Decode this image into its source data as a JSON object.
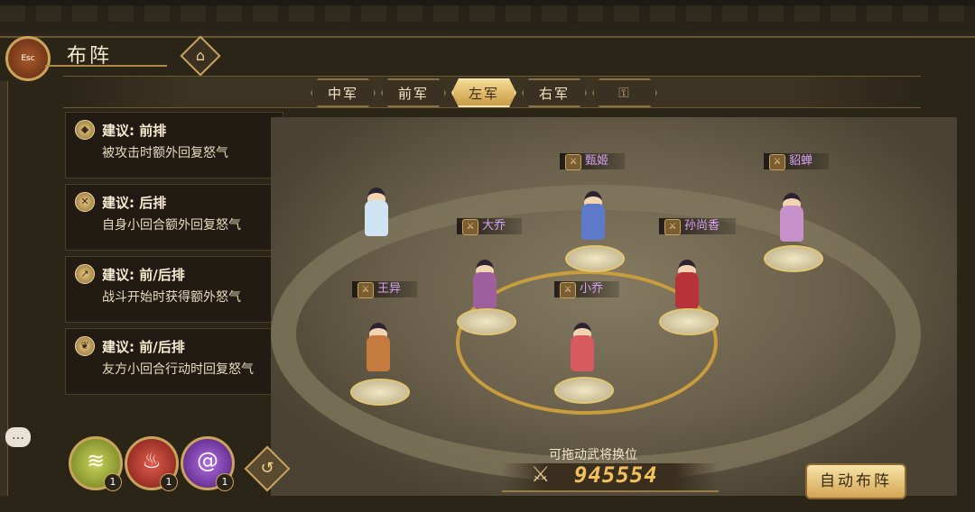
{
  "header": {
    "esc_label": "Esc",
    "title": "布阵"
  },
  "tabs": [
    {
      "label": "中军",
      "active": false
    },
    {
      "label": "前军",
      "active": false
    },
    {
      "label": "左军",
      "active": true
    },
    {
      "label": "右军",
      "active": false
    },
    {
      "label": "",
      "active": false
    }
  ],
  "suggestions": [
    {
      "head": "建议: 前排",
      "desc": "被攻击时额外回复怒气",
      "icon": "shield-icon"
    },
    {
      "head": "建议: 后排",
      "desc": "自身小回合额外回复怒气",
      "icon": "sword-icon"
    },
    {
      "head": "建议: 前/后排",
      "desc": "战斗开始时获得额外怒气",
      "icon": "spear-icon"
    },
    {
      "head": "建议: 前/后排",
      "desc": "友方小回合行动时回复怒气",
      "icon": "leaf-icon"
    }
  ],
  "heroes": [
    {
      "name": "甄姬"
    },
    {
      "name": "貂蝉"
    },
    {
      "name": "大乔"
    },
    {
      "name": "孙尚香"
    },
    {
      "name": "王异"
    },
    {
      "name": "小乔"
    },
    {
      "name": ""
    }
  ],
  "skills": [
    {
      "icon": "wind-icon",
      "count": "1",
      "color": "#8d9a2c"
    },
    {
      "icon": "fire-icon",
      "count": "1",
      "color": "#a2302a"
    },
    {
      "icon": "vortex-icon",
      "count": "1",
      "color": "#7a3aa6"
    }
  ],
  "hint": "可拖动武将换位",
  "power": "945554",
  "auto_button": "自动布阵"
}
